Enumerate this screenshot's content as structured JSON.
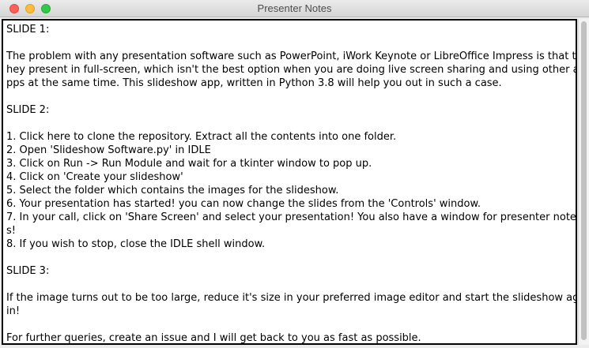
{
  "window": {
    "title": "Presenter Notes"
  },
  "notes": {
    "lines": [
      "SLIDE 1:",
      "",
      "The problem with any presentation software such as PowerPoint, iWork Keynote or LibreOffice Impress is that t",
      "hey present in full-screen, which isn't the best option when you are doing live screen sharing and using other a",
      "pps at the same time. This slideshow app, written in Python 3.8 will help you out in such a case.",
      "",
      "SLIDE 2:",
      "",
      "1. Click here to clone the repository. Extract all the contents into one folder.",
      "2. Open 'Slideshow Software.py' in IDLE",
      "3. Click on Run -> Run Module and wait for a tkinter window to pop up.",
      "4. Click on 'Create your slideshow'",
      "5. Select the folder which contains the images for the slideshow.",
      "6. Your presentation has started! you can now change the slides from the 'Controls' window.",
      "7. In your call, click on 'Share Screen' and select your presentation! You also have a window for presenter note",
      "s!",
      "8. If you wish to stop, close the IDLE shell window.",
      "",
      "SLIDE 3:",
      "",
      "If the image turns out to be too large, reduce it's size in your preferred image editor and start the slideshow aga",
      "in!",
      "",
      "For further queries, create an issue and I will get back to you as fast as possible."
    ]
  }
}
